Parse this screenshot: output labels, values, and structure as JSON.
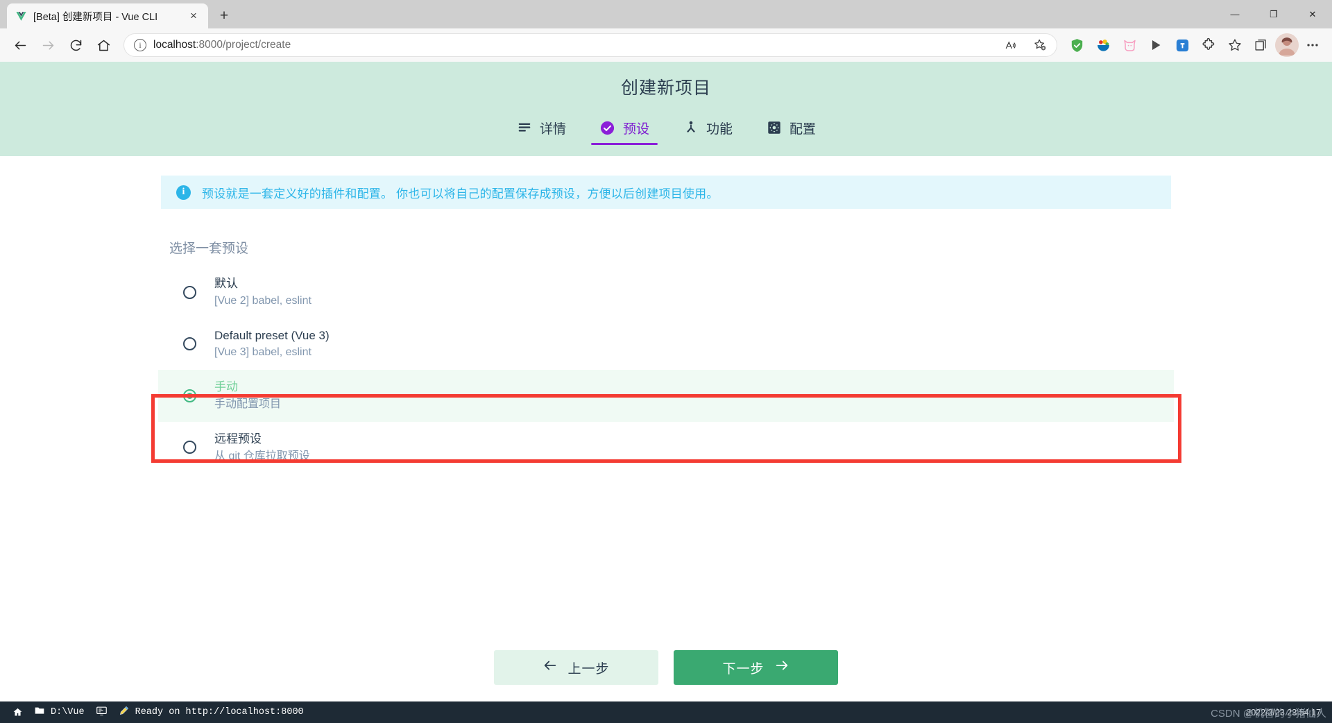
{
  "browser": {
    "tab": {
      "title": "[Beta] 创建新项目 - Vue CLI",
      "favicon": "vue-logo-icon",
      "close_label": "×"
    },
    "newtab_label": "+",
    "window_controls": {
      "minimize": "—",
      "maximize": "❐",
      "close": "✕"
    },
    "nav": {
      "back": "←",
      "forward": "→",
      "reload": "⟳",
      "home": "⌂"
    },
    "omnibox": {
      "url_host": "localhost",
      "url_path": ":8000/project/create",
      "full_url": "localhost:8000/project/create",
      "site_info_icon": "info-circle-icon",
      "read_aloud_icon": "read-aloud-icon",
      "favorite_icon": "add-favorite-star-icon"
    },
    "extensions": [
      {
        "name": "adguard-shield-icon",
        "color": "#4caf50"
      },
      {
        "name": "colorful-bowl-icon",
        "color": "#2196a8"
      },
      {
        "name": "pink-cat-icon",
        "color": "#f7a6c4"
      },
      {
        "name": "play-triangle-icon",
        "color": "#4a4a4a"
      },
      {
        "name": "blue-app-icon",
        "color": "#2a7fd4"
      },
      {
        "name": "puzzle-extensions-icon",
        "color": "#444444"
      },
      {
        "name": "favorites-star-icon",
        "color": "#444444"
      },
      {
        "name": "collections-icon",
        "color": "#444444"
      }
    ],
    "avatar_name": "profile-avatar",
    "settings_more": "⋯"
  },
  "vue_cli": {
    "header": {
      "title": "创建新项目"
    },
    "tabs": [
      {
        "label": "详情",
        "icon": "list-lines-icon",
        "active": false
      },
      {
        "label": "预设",
        "icon": "check-circle-icon",
        "active": true
      },
      {
        "label": "功能",
        "icon": "person-features-icon",
        "active": false
      },
      {
        "label": "配置",
        "icon": "gear-config-icon",
        "active": false
      }
    ],
    "banner": {
      "icon": "info-icon",
      "text": "预设就是一套定义好的插件和配置。 你也可以将自己的配置保存成预设，方便以后创建项目使用。",
      "color": "#2cb5e8"
    },
    "section_title": "选择一套预设",
    "presets": [
      {
        "name": "默认",
        "desc": "[Vue 2] babel, eslint",
        "selected": false
      },
      {
        "name": "Default preset (Vue 3)",
        "desc": "[Vue 3] babel, eslint",
        "selected": false
      },
      {
        "name": "手动",
        "desc": "手动配置项目",
        "selected": true
      },
      {
        "name": "远程预设",
        "desc": "从 git 仓库拉取预设",
        "selected": false
      }
    ],
    "highlight": {
      "name": "red-annotation-box",
      "color": "#f43b32",
      "target_index": 2
    },
    "buttons": {
      "prev": {
        "label": "上一步",
        "icon": "arrow-left-icon"
      },
      "next": {
        "label": "下一步",
        "icon": "arrow-right-icon"
      }
    },
    "accent_green": "#42b983",
    "accent_purple": "#8b1fd8"
  },
  "taskbar": {
    "start_icon": "home-icon",
    "items": [
      {
        "icon": "folder-icon",
        "label": "D:\\Vue"
      },
      {
        "icon": "terminal-icon",
        "label": ""
      },
      {
        "icon": "pen-icon",
        "label": "Ready on http://localhost:8000"
      }
    ],
    "clock": "2022/3/23 23:54:17",
    "watermark": "CSDN @机智的小猪仙人"
  }
}
